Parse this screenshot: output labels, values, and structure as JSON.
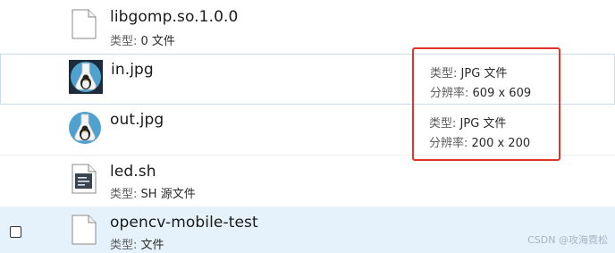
{
  "files": [
    {
      "name": "libgomp.so.1.0.0",
      "type_label": "类型:",
      "type_value": "0 文件",
      "icon": "blank-file-icon"
    },
    {
      "name": "in.jpg",
      "icon": "image-thumbnail-icon",
      "type_label": "类型:",
      "type_value": "JPG 文件",
      "resolution_label": "分辨率:",
      "resolution_value": "609 x 609"
    },
    {
      "name": "out.jpg",
      "icon": "image-thumbnail-icon",
      "type_label": "类型:",
      "type_value": "JPG 文件",
      "resolution_label": "分辨率:",
      "resolution_value": "200 x 200"
    },
    {
      "name": "led.sh",
      "type_label": "类型:",
      "type_value": "SH 源文件",
      "icon": "script-file-icon"
    },
    {
      "name": "opencv-mobile-test",
      "type_label": "类型:",
      "type_value": "文件",
      "icon": "blank-file-icon"
    }
  ],
  "watermark": "CSDN @攻海霓松"
}
